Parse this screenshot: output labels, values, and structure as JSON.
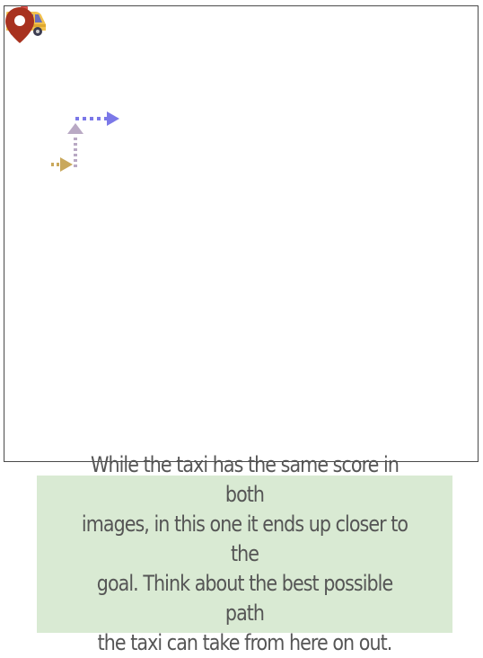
{
  "caption": {
    "lines": [
      "While the taxi has the same score in both",
      "images, in this one it ends up closer to the",
      "goal. Think about the best possible path",
      "the taxi can take from here on out."
    ]
  },
  "colors": {
    "board_border": "#4a4a4a",
    "caption_bg": "#d9ead3",
    "caption_text": "#555555",
    "taxi_body": "#f2c14e",
    "arrow_1": "#c9a85c",
    "arrow_2": "#b9a9c4",
    "arrow_3": "#7b78e8",
    "goal_pin": "#a8321f"
  },
  "icons": {
    "taxi": "taxi-icon",
    "goal": "map-pin-icon",
    "path": "dotted-arrow-icon"
  }
}
